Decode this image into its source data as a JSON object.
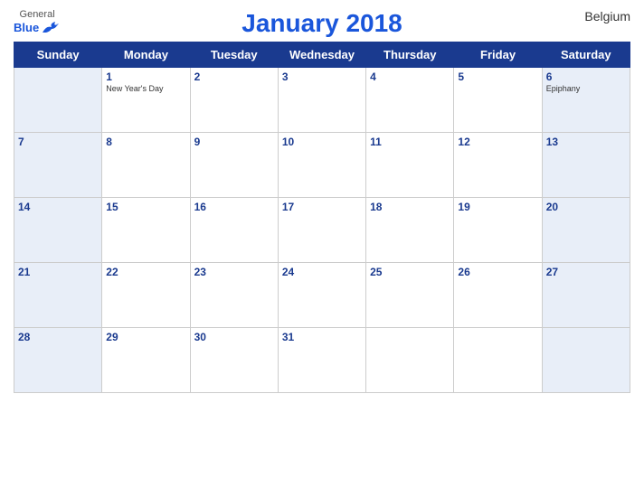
{
  "header": {
    "logo_general": "General",
    "logo_blue": "Blue",
    "title": "January 2018",
    "country": "Belgium"
  },
  "days_of_week": [
    "Sunday",
    "Monday",
    "Tuesday",
    "Wednesday",
    "Thursday",
    "Friday",
    "Saturday"
  ],
  "weeks": [
    [
      {
        "day": "",
        "holiday": ""
      },
      {
        "day": "1",
        "holiday": "New Year's Day"
      },
      {
        "day": "2",
        "holiday": ""
      },
      {
        "day": "3",
        "holiday": ""
      },
      {
        "day": "4",
        "holiday": ""
      },
      {
        "day": "5",
        "holiday": ""
      },
      {
        "day": "6",
        "holiday": "Epiphany"
      }
    ],
    [
      {
        "day": "7",
        "holiday": ""
      },
      {
        "day": "8",
        "holiday": ""
      },
      {
        "day": "9",
        "holiday": ""
      },
      {
        "day": "10",
        "holiday": ""
      },
      {
        "day": "11",
        "holiday": ""
      },
      {
        "day": "12",
        "holiday": ""
      },
      {
        "day": "13",
        "holiday": ""
      }
    ],
    [
      {
        "day": "14",
        "holiday": ""
      },
      {
        "day": "15",
        "holiday": ""
      },
      {
        "day": "16",
        "holiday": ""
      },
      {
        "day": "17",
        "holiday": ""
      },
      {
        "day": "18",
        "holiday": ""
      },
      {
        "day": "19",
        "holiday": ""
      },
      {
        "day": "20",
        "holiday": ""
      }
    ],
    [
      {
        "day": "21",
        "holiday": ""
      },
      {
        "day": "22",
        "holiday": ""
      },
      {
        "day": "23",
        "holiday": ""
      },
      {
        "day": "24",
        "holiday": ""
      },
      {
        "day": "25",
        "holiday": ""
      },
      {
        "day": "26",
        "holiday": ""
      },
      {
        "day": "27",
        "holiday": ""
      }
    ],
    [
      {
        "day": "28",
        "holiday": ""
      },
      {
        "day": "29",
        "holiday": ""
      },
      {
        "day": "30",
        "holiday": ""
      },
      {
        "day": "31",
        "holiday": ""
      },
      {
        "day": "",
        "holiday": ""
      },
      {
        "day": "",
        "holiday": ""
      },
      {
        "day": "",
        "holiday": ""
      }
    ]
  ]
}
